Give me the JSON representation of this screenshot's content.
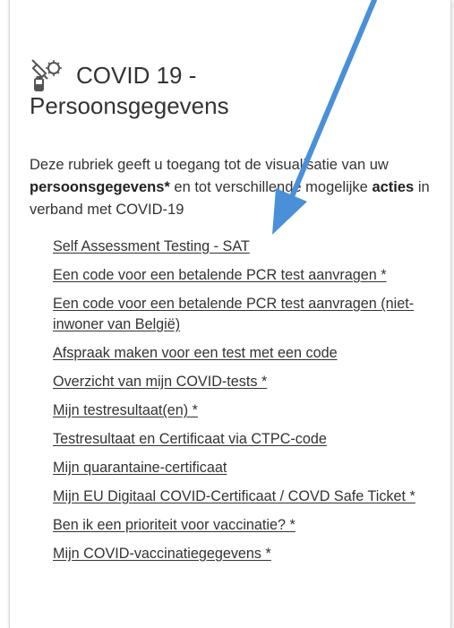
{
  "page": {
    "title_line1": "COVID 19 -",
    "title_line2": "Persoonsgegevens",
    "title_icon": "covid-vaccine-icon"
  },
  "intro": {
    "part1": "Deze rubriek geeft u toegang tot de visualisatie van uw ",
    "bold1": "persoonsgegevens*",
    "part2": " en tot verschillende mogelijke ",
    "bold2": "acties",
    "part3": " in verband met COVID-19"
  },
  "links": [
    "Self Assessment Testing - SAT",
    "Een code voor een betalende PCR test aanvragen *",
    "Een code voor een betalende PCR test aanvragen (niet-inwoner van België)",
    "Afspraak maken voor een test met een code",
    "Overzicht van mijn COVID-tests *",
    "Mijn testresultaat(en) *",
    "Testresultaat en Certificaat via CTPC-code",
    "Mijn quarantaine-certificaat",
    "Mijn EU Digitaal COVID-Certificaat / COVD Safe Ticket *",
    "Ben ik een prioriteit voor vaccinatie? *",
    "Mijn COVID-vaccinatiegegevens *"
  ],
  "colors": {
    "annotation_arrow": "#4a90d9",
    "text": "#333333"
  }
}
